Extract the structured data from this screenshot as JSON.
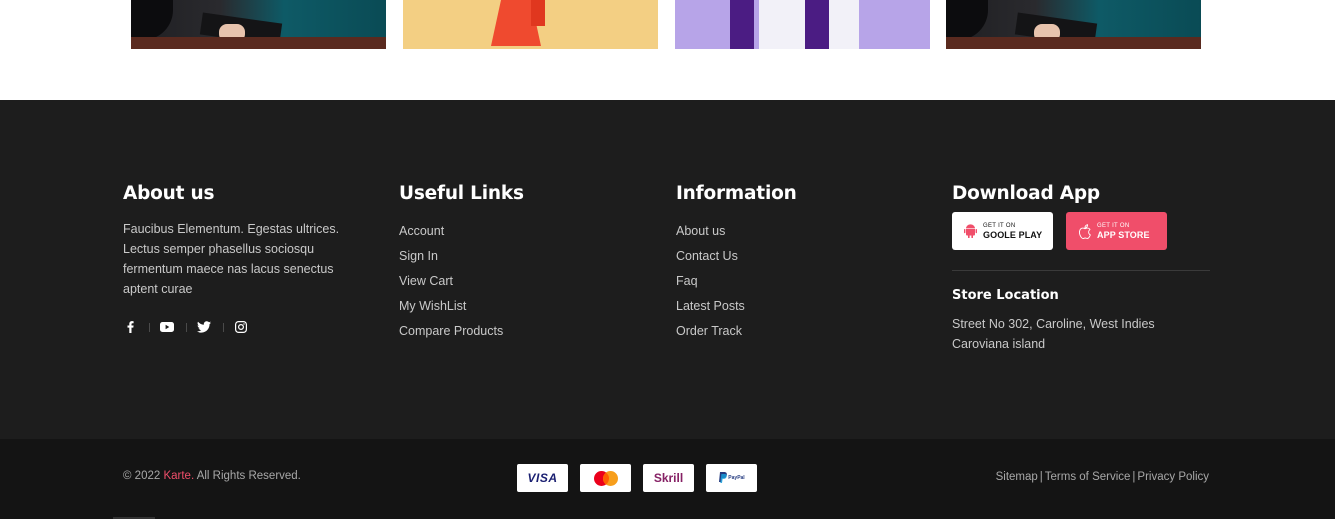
{
  "about": {
    "title": "About us",
    "text": "Faucibus Elementum. Egestas ultrices. Lectus semper phasellus sociosqu fermentum maece nas lacus senectus aptent curae",
    "social_icons": [
      "facebook-icon",
      "youtube-icon",
      "twitter-icon",
      "instagram-icon"
    ]
  },
  "useful_links": {
    "title": "Useful Links",
    "items": [
      "Account",
      "Sign In",
      "View Cart",
      "My WishList",
      "Compare Products"
    ]
  },
  "information": {
    "title": "Information",
    "items": [
      "About us",
      "Contact Us",
      "Faq",
      "Latest Posts",
      "Order Track"
    ]
  },
  "download_app": {
    "title": "Download App",
    "google_play": {
      "small": "GET IT ON",
      "big": "GOOLE PLAY",
      "icon": "android-icon"
    },
    "app_store": {
      "small": "GET IT ON",
      "big": "APP STORE",
      "icon": "apple-icon"
    },
    "accent_color": "#f04e6a"
  },
  "store_location": {
    "title": "Store Location",
    "line1": "Street No 302, Caroline, West Indies",
    "line2": "Caroviana island"
  },
  "bottom_bar": {
    "copyright_prefix": "© 2022 ",
    "brand": "Karte.",
    "copyright_suffix": " All Rights Reserved.",
    "payments": [
      "VISA",
      "Mastercard",
      "Skrill",
      "PayPal"
    ],
    "legal": [
      "Sitemap",
      "Terms of Service",
      "Privacy Policy"
    ]
  }
}
